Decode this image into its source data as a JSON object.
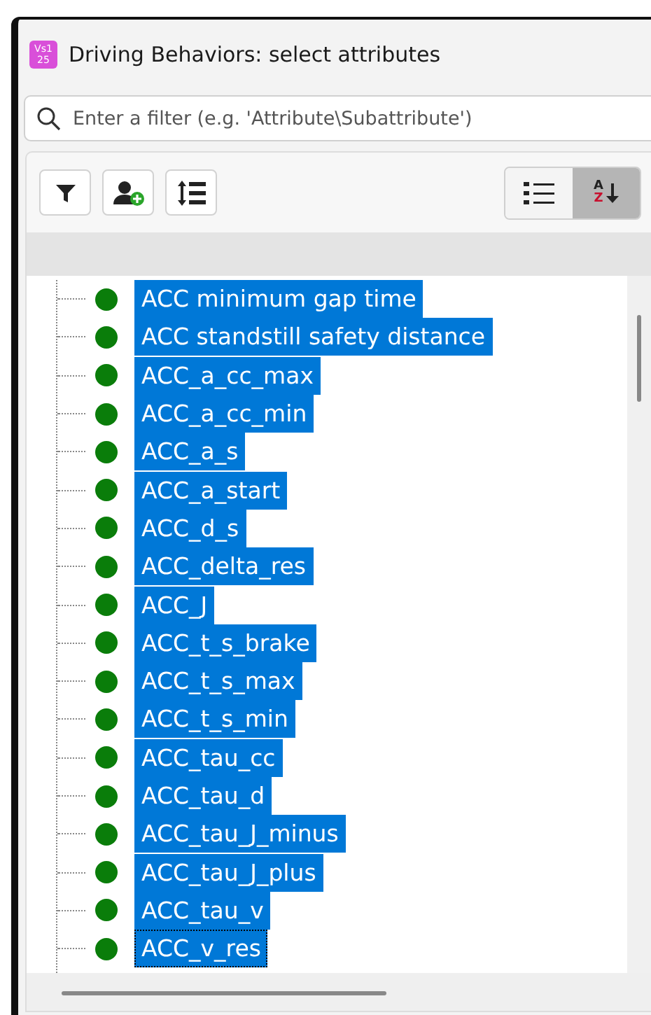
{
  "window": {
    "title": "Driving Behaviors: select attributes",
    "app_icon": [
      "Vs1",
      "25"
    ]
  },
  "filter": {
    "placeholder": "Enter a filter (e.g. 'Attribute\\Subattribute')"
  },
  "toolbar": [
    {
      "kind": "filter"
    },
    {
      "kind": "add-user"
    },
    {
      "kind": "indent"
    }
  ],
  "view_toggles": [
    {
      "kind": "list",
      "selected": false
    },
    {
      "kind": "sort-az",
      "selected": true,
      "letters": [
        "A",
        "Z"
      ]
    }
  ],
  "items": [
    {
      "label": "ACC minimum gap time",
      "selected": true,
      "focused": false
    },
    {
      "label": "ACC standstill safety distance",
      "selected": true,
      "focused": false
    },
    {
      "label": "ACC_a_cc_max",
      "selected": true,
      "focused": false
    },
    {
      "label": "ACC_a_cc_min",
      "selected": true,
      "focused": false
    },
    {
      "label": "ACC_a_s",
      "selected": true,
      "focused": false
    },
    {
      "label": "ACC_a_start",
      "selected": true,
      "focused": false
    },
    {
      "label": "ACC_d_s",
      "selected": true,
      "focused": false
    },
    {
      "label": "ACC_delta_res",
      "selected": true,
      "focused": false
    },
    {
      "label": "ACC_J",
      "selected": true,
      "focused": false
    },
    {
      "label": "ACC_t_s_brake",
      "selected": true,
      "focused": false
    },
    {
      "label": "ACC_t_s_max",
      "selected": true,
      "focused": false
    },
    {
      "label": "ACC_t_s_min",
      "selected": true,
      "focused": false
    },
    {
      "label": "ACC_tau_cc",
      "selected": true,
      "focused": false
    },
    {
      "label": "ACC_tau_d",
      "selected": true,
      "focused": false
    },
    {
      "label": "ACC_tau_J_minus",
      "selected": true,
      "focused": false
    },
    {
      "label": "ACC_tau_J_plus",
      "selected": true,
      "focused": false
    },
    {
      "label": "ACC_tau_v",
      "selected": true,
      "focused": false
    },
    {
      "label": "ACC_v_res",
      "selected": true,
      "focused": true
    }
  ]
}
